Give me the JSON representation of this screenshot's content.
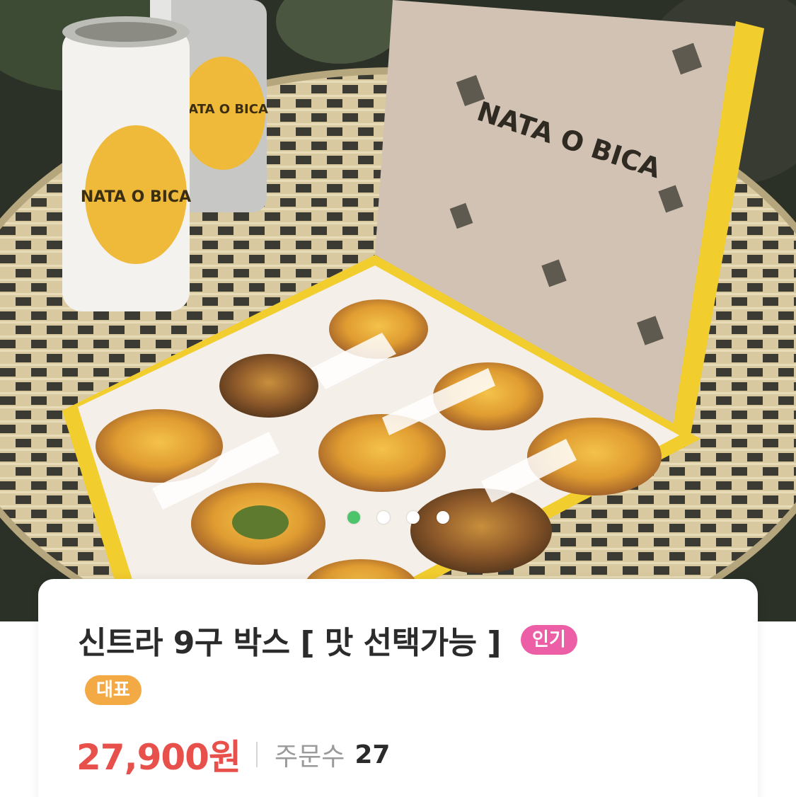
{
  "hero": {
    "image_alt": "NATA O BICA",
    "box_brand": "NATA O BICA",
    "can_brand": "NATA O BICA",
    "carousel": {
      "total": 4,
      "active_index": 0
    }
  },
  "product": {
    "title": "신트라 9구 박스 [ 맛 선택가능 ]",
    "badges": {
      "popular": "인기",
      "representative": "대표"
    },
    "price": "27,900원",
    "orders_label": "주문수",
    "orders_count": "27"
  },
  "colors": {
    "price": "#e8504b",
    "badge_popular": "#ec5ea6",
    "badge_representative": "#f3a944",
    "carousel_active": "#4cc46b",
    "box_yellow": "#f2cd2e"
  }
}
